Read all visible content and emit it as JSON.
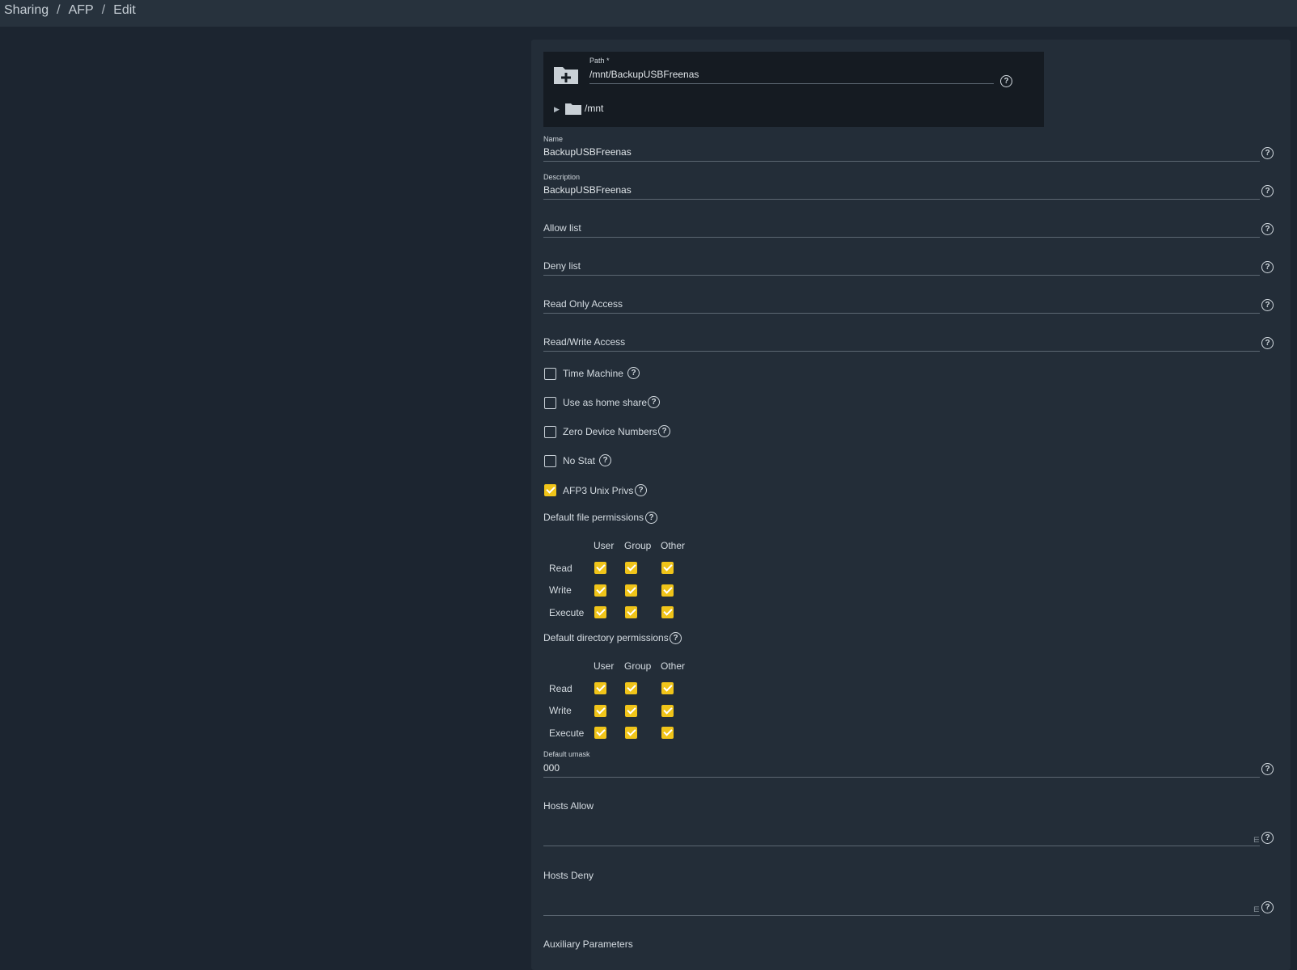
{
  "breadcrumb": [
    "Sharing",
    "AFP",
    "Edit"
  ],
  "path": {
    "label": "Path *",
    "value": "/mnt/BackupUSBFreenas",
    "tree_root": "/mnt"
  },
  "fields": {
    "name": {
      "label": "Name",
      "value": "BackupUSBFreenas"
    },
    "description": {
      "label": "Description",
      "value": "BackupUSBFreenas"
    },
    "allow_list": {
      "placeholder": "Allow list"
    },
    "deny_list": {
      "placeholder": "Deny list"
    },
    "read_only_access": {
      "placeholder": "Read Only Access"
    },
    "read_write_access": {
      "placeholder": "Read/Write Access"
    },
    "default_umask": {
      "label": "Default umask",
      "value": "000"
    },
    "hosts_allow": {
      "placeholder": "Hosts Allow"
    },
    "hosts_deny": {
      "placeholder": "Hosts Deny"
    },
    "auxiliary_parameters": {
      "placeholder": "Auxiliary Parameters"
    }
  },
  "checkboxes": [
    {
      "label": "Time Machine",
      "checked": false
    },
    {
      "label": "Use as home share",
      "checked": false
    },
    {
      "label": "Zero Device Numbers",
      "checked": false
    },
    {
      "label": "No Stat",
      "checked": false
    },
    {
      "label": "AFP3 Unix Privs",
      "checked": true
    }
  ],
  "file_permissions": {
    "title": "Default file permissions",
    "columns": [
      "User",
      "Group",
      "Other"
    ],
    "rows": [
      {
        "label": "Read",
        "values": [
          true,
          true,
          true
        ]
      },
      {
        "label": "Write",
        "values": [
          true,
          true,
          true
        ]
      },
      {
        "label": "Execute",
        "values": [
          true,
          true,
          true
        ]
      }
    ]
  },
  "directory_permissions": {
    "title": "Default directory permissions",
    "columns": [
      "User",
      "Group",
      "Other"
    ],
    "rows": [
      {
        "label": "Read",
        "values": [
          true,
          true,
          true
        ]
      },
      {
        "label": "Write",
        "values": [
          true,
          true,
          true
        ]
      },
      {
        "label": "Execute",
        "values": [
          true,
          true,
          true
        ]
      }
    ]
  },
  "help_glyph": "?",
  "icons": {
    "folder_add": "folder-plus-icon",
    "folder": "folder-icon",
    "help": "help-circle-icon",
    "expand": "triangle-right-icon"
  },
  "colors": {
    "accent": "#f0c419",
    "page_bg": "#1c2530",
    "card_bg": "#232d38",
    "tree_bg": "#151b22",
    "topbar_bg": "#27323d"
  }
}
